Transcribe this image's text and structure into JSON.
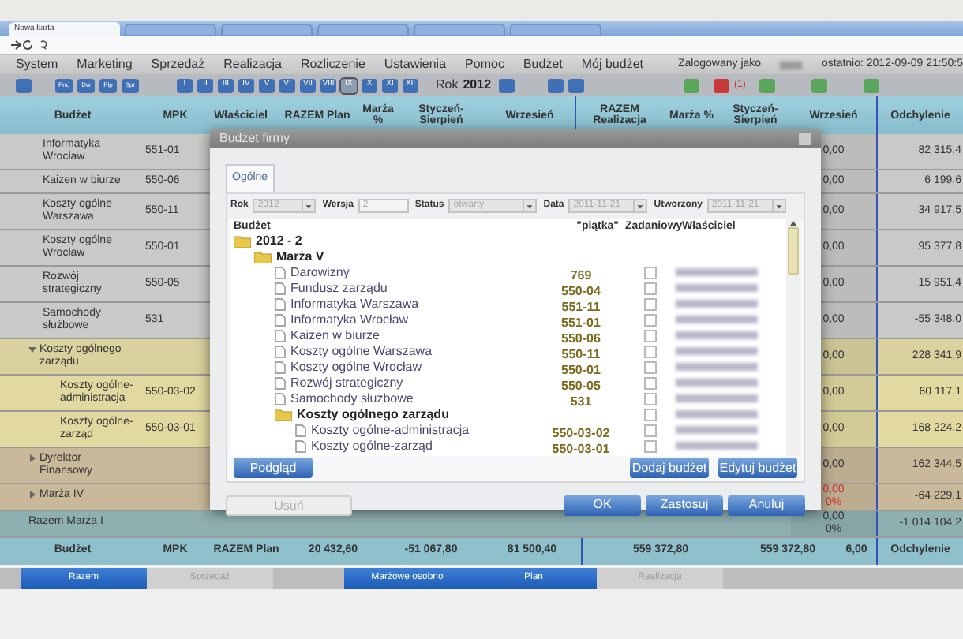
{
  "browser": {
    "tabs": [
      {
        "title": "Nowa karta",
        "selected": true
      },
      {
        "selected": false
      },
      {
        "selected": false
      },
      {
        "selected": false
      },
      {
        "selected": false
      },
      {
        "selected": false
      }
    ]
  },
  "menu": {
    "items": [
      "System",
      "Marketing",
      "Sprzedaż",
      "Realizacja",
      "Rozliczenie",
      "Ustawienia",
      "Pomoc",
      "Budżet",
      "Mój budżet"
    ],
    "login_label": "Zalogowany jako",
    "last_login": "ostatnio: 2012-09-09 21:50:5"
  },
  "toolbar": {
    "quick": [
      "Pno",
      "Dw",
      "Plp",
      "Spr"
    ],
    "months": [
      {
        "label": "I",
        "selected": false
      },
      {
        "label": "II",
        "selected": false
      },
      {
        "label": "III",
        "selected": false
      },
      {
        "label": "IV",
        "selected": false
      },
      {
        "label": "V",
        "selected": false
      },
      {
        "label": "VI",
        "selected": false
      },
      {
        "label": "VII",
        "selected": false
      },
      {
        "label": "VIII",
        "selected": false
      },
      {
        "label": "IX",
        "selected": true
      },
      {
        "label": "X",
        "selected": false
      },
      {
        "label": "XI",
        "selected": false
      },
      {
        "label": "XII",
        "selected": false
      }
    ],
    "year_label": "Rok",
    "year": "2012",
    "alert_count": "(1)"
  },
  "table": {
    "columns": [
      "Budżet",
      "MPK",
      "Właściciel",
      "RAZEM Plan",
      "Marża %",
      "Styczeń-Sierpień",
      "Wrzesień",
      "RAZEM Realizacja",
      "Marża %",
      "Styczeń-Sierpień",
      "Wrzesień",
      "Odchylenie"
    ],
    "rows": [
      {
        "kind": "item",
        "name": "Informatyka Wrocław",
        "mpk": "551-01",
        "wrzesien": "0,00",
        "odchylenie": "82 315,4"
      },
      {
        "kind": "item",
        "name": "Kaizen w biurze",
        "mpk": "550-06",
        "wrzesien": "0,00",
        "odchylenie": "6 199,6"
      },
      {
        "kind": "item",
        "name": "Koszty ogólne Warszawa",
        "mpk": "550-11",
        "wrzesien": "0,00",
        "odchylenie": "34 917,5"
      },
      {
        "kind": "item",
        "name": "Koszty ogólne Wrocław",
        "mpk": "550-01",
        "wrzesien": "0,00",
        "odchylenie": "95 377,8"
      },
      {
        "kind": "item",
        "name": "Rozwój strategiczny",
        "mpk": "550-05",
        "wrzesien": "0,00",
        "odchylenie": "15 951,4"
      },
      {
        "kind": "item",
        "name": "Samochody służbowe",
        "mpk": "531",
        "wrzesien": "0,00",
        "odchylenie": "-55 348,0"
      },
      {
        "kind": "group",
        "name": "Koszty ogólnego zarządu",
        "expanded": true,
        "wrzesien": "0,00",
        "odchylenie": "228 341,9"
      },
      {
        "kind": "subitem",
        "name": "Koszty ogólne-administracja",
        "mpk": "550-03-02",
        "wrzesien": "0,00",
        "odchylenie": "60 117,1"
      },
      {
        "kind": "subitem",
        "name": "Koszty ogólne-zarząd",
        "mpk": "550-03-01",
        "wrzesien": "0,00",
        "odchylenie": "168 224,2"
      },
      {
        "kind": "section",
        "name": "Dyrektor Finansowy",
        "expanded": false,
        "wrzesien": "0,00",
        "odchylenie": "162 344,5"
      },
      {
        "kind": "section",
        "name": "Marża IV",
        "expanded": false,
        "wrzesien": "0,00",
        "percent": "0%",
        "alert": true,
        "odchylenie": "-64 229,1"
      },
      {
        "kind": "total",
        "name": "Razem Marża I",
        "wrzesien": "0,00",
        "percent": "0%",
        "alert": false,
        "odchylenie": "-1 014 104,2"
      }
    ],
    "footer": [
      "Budżet",
      "MPK",
      "RAZEM Plan",
      "20 432,60",
      "-51 067,80",
      "81 500,40",
      "559 372,80",
      "559 372,80",
      "6,00",
      "Odchylenie"
    ]
  },
  "bottom_tabs": [
    {
      "label": "Razem",
      "selected": true
    },
    {
      "label": "Sprzedaż",
      "selected": false
    },
    {
      "label": "Marżowe osobno",
      "selected": true
    },
    {
      "label": "Plan",
      "selected": true
    },
    {
      "label": "Realizacja",
      "selected": false
    }
  ],
  "dialog": {
    "title": "Budżet firmy",
    "tab": "Ogólne",
    "fields": [
      {
        "label": "Rok",
        "value": "2012",
        "kind": "select"
      },
      {
        "label": "Wersja",
        "value": "2",
        "kind": "text"
      },
      {
        "label": "Status",
        "value": "otwarty",
        "kind": "select"
      },
      {
        "label": "Data",
        "value": "2011-11-21",
        "kind": "select"
      },
      {
        "label": "Utworzony",
        "value": "2011-11-21",
        "kind": "select"
      }
    ],
    "tree_columns": [
      "Budżet",
      "\"piątka\"",
      "Zadaniowy",
      "Właściciel"
    ],
    "tree": [
      {
        "name": "2012 - 2",
        "kind": "folder",
        "children": [
          {
            "name": "Marża V",
            "kind": "folder",
            "children": [
              {
                "name": "Darowizny",
                "kind": "leaf",
                "code": "769",
                "checked": false
              },
              {
                "name": "Fundusz zarządu",
                "kind": "leaf",
                "code": "550-04",
                "checked": false
              },
              {
                "name": "Informatyka Warszawa",
                "kind": "leaf",
                "code": "551-11",
                "checked": false
              },
              {
                "name": "Informatyka Wrocław",
                "kind": "leaf",
                "code": "551-01",
                "checked": false
              },
              {
                "name": "Kaizen w biurze",
                "kind": "leaf",
                "code": "550-06",
                "checked": false
              },
              {
                "name": "Koszty ogólne Warszawa",
                "kind": "leaf",
                "code": "550-11",
                "checked": false
              },
              {
                "name": "Koszty ogólne Wrocław",
                "kind": "leaf",
                "code": "550-01",
                "checked": false
              },
              {
                "name": "Rozwój strategiczny",
                "kind": "leaf",
                "code": "550-05",
                "checked": false
              },
              {
                "name": "Samochody służbowe",
                "kind": "leaf",
                "code": "531",
                "checked": false
              },
              {
                "name": "Koszty ogólnego zarządu",
                "kind": "folder",
                "checked": false,
                "children": [
                  {
                    "name": "Koszty ogólne-administracja",
                    "kind": "leaf",
                    "code": "550-03-02",
                    "checked": false
                  },
                  {
                    "name": "Koszty ogólne-zarząd",
                    "kind": "leaf",
                    "code": "550-03-01",
                    "checked": false
                  }
                ]
              }
            ]
          }
        ]
      }
    ],
    "panel_buttons": [
      {
        "label": "Podgląd",
        "disabled": false
      },
      {
        "label": "Dodaj budżet",
        "disabled": false
      },
      {
        "label": "Edytuj budżet",
        "disabled": false
      }
    ],
    "buttons": [
      {
        "label": "Usuń",
        "disabled": true
      },
      {
        "label": "OK",
        "disabled": false
      },
      {
        "label": "Zastosuj",
        "disabled": false
      },
      {
        "label": "Anuluj",
        "disabled": false
      }
    ]
  }
}
